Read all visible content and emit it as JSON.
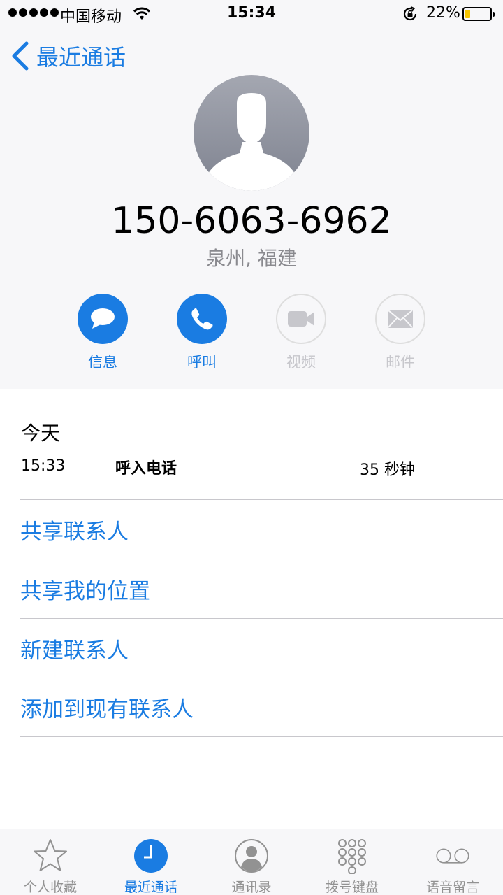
{
  "status_bar": {
    "carrier": "中国移动",
    "time": "15:34",
    "battery_percent": "22%",
    "battery_level": 0.22,
    "battery_color": "#f5c400",
    "signal_bars": 5
  },
  "nav": {
    "back_label": "最近通话",
    "back_icon": "chevron-left-icon"
  },
  "contact": {
    "avatar_icon": "person-silhouette-icon",
    "phone_number": "150-6063-6962",
    "location": "泉州, 福建"
  },
  "actions": [
    {
      "label": "信息",
      "icon": "message-bubble-icon",
      "enabled": true
    },
    {
      "label": "呼叫",
      "icon": "phone-icon",
      "enabled": true
    },
    {
      "label": "视频",
      "icon": "video-camera-icon",
      "enabled": false
    },
    {
      "label": "邮件",
      "icon": "envelope-icon",
      "enabled": false
    }
  ],
  "history": {
    "day": "今天",
    "entries": [
      {
        "time": "15:33",
        "type": "呼入电话",
        "duration": "35 秒钟"
      }
    ]
  },
  "links": [
    "共享联系人",
    "共享我的位置",
    "新建联系人",
    "添加到现有联系人"
  ],
  "tabs": [
    {
      "label": "个人收藏",
      "icon": "star-icon",
      "active": false
    },
    {
      "label": "最近通话",
      "icon": "clock-icon",
      "active": true
    },
    {
      "label": "通讯录",
      "icon": "contacts-icon",
      "active": false
    },
    {
      "label": "拨号键盘",
      "icon": "keypad-icon",
      "active": false
    },
    {
      "label": "语音留言",
      "icon": "voicemail-icon",
      "active": false
    }
  ],
  "colors": {
    "accent": "#1a7ce2",
    "disabled": "#c7c7cc",
    "separator": "#c8c7cc",
    "header_bg": "#f7f7f9"
  }
}
